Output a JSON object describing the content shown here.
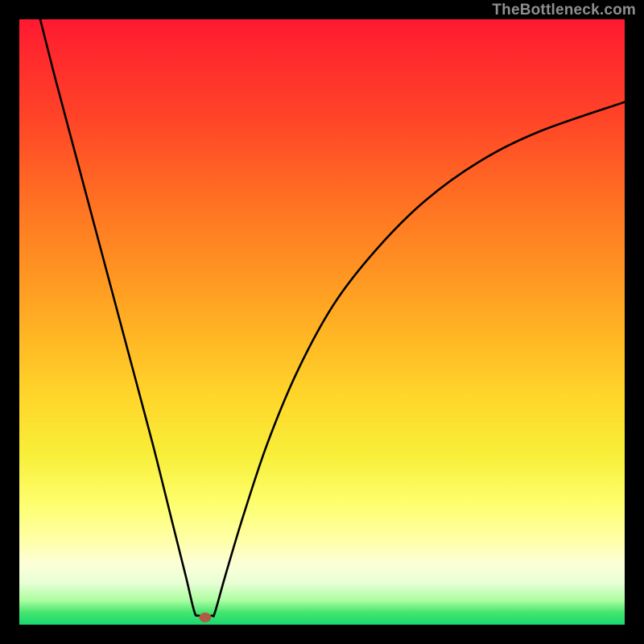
{
  "watermark": "TheBottleneck.com",
  "chart_data": {
    "type": "line",
    "title": "",
    "xlabel": "",
    "ylabel": "",
    "xlim": [
      0,
      100
    ],
    "ylim": [
      0,
      100
    ],
    "gradient_colors": {
      "top": "#ff1930",
      "mid_orange": "#ff8f22",
      "mid_yellow": "#f8ef39",
      "bottom": "#19d86f"
    },
    "minimum_marker": {
      "x": 30.7,
      "y": 1.2,
      "color": "#b25b44"
    },
    "series": [
      {
        "name": "bottleneck-curve",
        "points": [
          {
            "x": 3.2,
            "y": 101.0
          },
          {
            "x": 6.0,
            "y": 90.0
          },
          {
            "x": 10.0,
            "y": 75.0
          },
          {
            "x": 14.0,
            "y": 60.0
          },
          {
            "x": 18.0,
            "y": 45.0
          },
          {
            "x": 22.0,
            "y": 30.0
          },
          {
            "x": 25.0,
            "y": 18.0
          },
          {
            "x": 27.5,
            "y": 8.0
          },
          {
            "x": 28.9,
            "y": 2.2
          },
          {
            "x": 29.6,
            "y": 1.5
          },
          {
            "x": 31.8,
            "y": 1.5
          },
          {
            "x": 32.3,
            "y": 2.0
          },
          {
            "x": 34.0,
            "y": 8.0
          },
          {
            "x": 37.0,
            "y": 18.0
          },
          {
            "x": 41.0,
            "y": 30.0
          },
          {
            "x": 46.0,
            "y": 42.0
          },
          {
            "x": 52.0,
            "y": 53.0
          },
          {
            "x": 59.0,
            "y": 62.0
          },
          {
            "x": 67.0,
            "y": 70.0
          },
          {
            "x": 76.0,
            "y": 76.5
          },
          {
            "x": 86.0,
            "y": 81.5
          },
          {
            "x": 100.5,
            "y": 86.5
          }
        ]
      }
    ]
  }
}
